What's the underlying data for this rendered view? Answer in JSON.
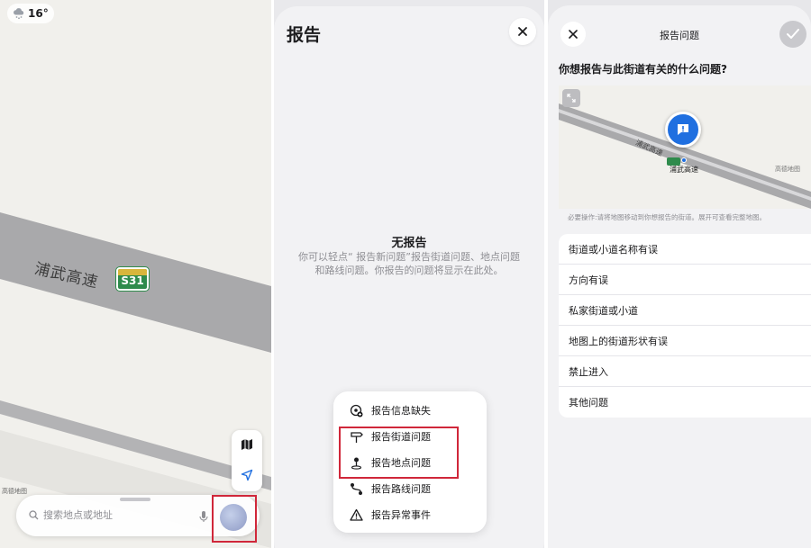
{
  "panel1": {
    "weather": {
      "temperature": "16°",
      "icon": "cloud-snow-icon"
    },
    "map": {
      "road_name": "浦武高速",
      "highway_shield": "S31",
      "attribution": "高德地图"
    },
    "search": {
      "placeholder": "搜索地点或地址"
    }
  },
  "panel2": {
    "title": "报告",
    "empty": {
      "title": "无报告",
      "description": "你可以轻点“ 报告新问题”报告街道问题、地点问题和路线问题。你报告的问题将显示在此处。"
    },
    "menu": [
      {
        "label": "报告信息缺失",
        "icon": "add-location-icon"
      },
      {
        "label": "报告街道问题",
        "icon": "signpost-icon"
      },
      {
        "label": "报告地点问题",
        "icon": "map-pin-icon"
      },
      {
        "label": "报告路线问题",
        "icon": "route-icon"
      },
      {
        "label": "报告异常事件",
        "icon": "warning-icon"
      }
    ]
  },
  "panel3": {
    "header": "报告问题",
    "question": "你想报告与此街道有关的什么问题?",
    "map": {
      "road_name": "浦武高速",
      "place": "浦武高速",
      "attribution": "高德地图"
    },
    "note": "必要操作:请将地图移动到你想报告的街道。展开可查看完整地图。",
    "options": [
      "街道或小道名称有误",
      "方向有误",
      "私家街道或小道",
      "地图上的街道形状有误",
      "禁止进入",
      "其他问题"
    ]
  },
  "colors": {
    "highlight_box": "#d0273a",
    "accent": "#1f6fe0",
    "highway_green": "#2f8b4c"
  }
}
